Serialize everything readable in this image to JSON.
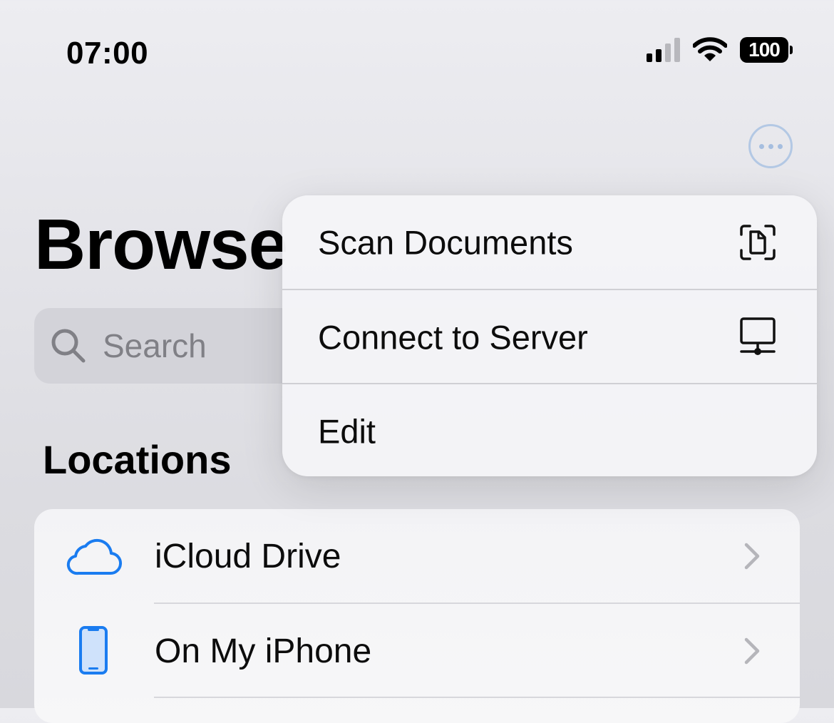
{
  "status_bar": {
    "time": "07:00",
    "battery": "100"
  },
  "header": {
    "title": "Browse",
    "more_icon": "ellipsis-circle-icon"
  },
  "search": {
    "placeholder": "Search"
  },
  "locations": {
    "header": "Locations",
    "items": [
      {
        "label": "iCloud Drive",
        "icon": "icloud-icon"
      },
      {
        "label": "On My iPhone",
        "icon": "iphone-icon"
      }
    ]
  },
  "context_menu": {
    "items": [
      {
        "label": "Scan Documents",
        "icon": "doc-viewfinder-icon"
      },
      {
        "label": "Connect to Server",
        "icon": "server-display-icon"
      },
      {
        "label": "Edit",
        "icon": ""
      }
    ]
  },
  "colors": {
    "accent": "#1a7cf0",
    "more_button": "#b3c8e4",
    "chevron": "#b5b5ba"
  }
}
